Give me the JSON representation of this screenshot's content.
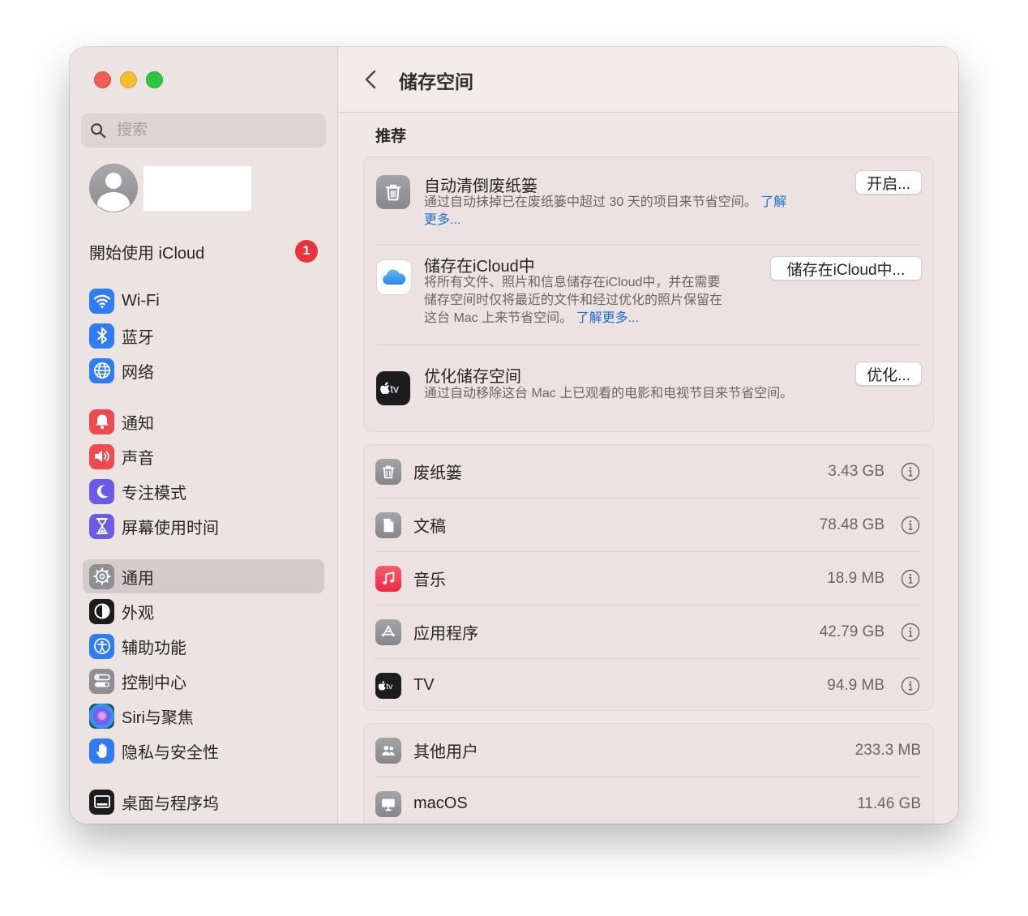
{
  "sidebar": {
    "search_placeholder": "搜索",
    "icloud_prompt": "開始使用 iCloud",
    "icloud_badge": "1",
    "items": [
      {
        "label": "Wi-Fi",
        "icon": "wifi-icon",
        "color": "#2f7cf6"
      },
      {
        "label": "蓝牙",
        "icon": "bluetooth-icon",
        "color": "#2f7cf6"
      },
      {
        "label": "网络",
        "icon": "globe-icon",
        "color": "#2f7cf6"
      },
      {
        "label": "通知",
        "icon": "bell-icon",
        "color": "#ee4a4f"
      },
      {
        "label": "声音",
        "icon": "speaker-icon",
        "color": "#ee4a4f"
      },
      {
        "label": "专注模式",
        "icon": "moon-icon",
        "color": "#6a5ce6"
      },
      {
        "label": "屏幕使用时间",
        "icon": "hourglass-icon",
        "color": "#6a5ce6"
      },
      {
        "label": "通用",
        "icon": "gear-icon",
        "color": "#8e8e93"
      },
      {
        "label": "外观",
        "icon": "appearance-icon",
        "color": "#1c1c1e"
      },
      {
        "label": "辅助功能",
        "icon": "accessibility-icon",
        "color": "#2f7cf6"
      },
      {
        "label": "控制中心",
        "icon": "control-center-icon",
        "color": "#8e8e93"
      },
      {
        "label": "Siri与聚焦",
        "icon": "siri-icon",
        "color": "#1c1c1e"
      },
      {
        "label": "隐私与安全性",
        "icon": "hand-icon",
        "color": "#2f7cf6"
      },
      {
        "label": "桌面与程序坞",
        "icon": "dock-icon",
        "color": "#1c1c1e"
      }
    ],
    "selected": "通用"
  },
  "header": {
    "title": "储存空间"
  },
  "recommendations": {
    "section_title": "推荐",
    "items": [
      {
        "title": "自动清倒废纸篓",
        "desc_line1": "通过自动抹掉已在废纸篓中超过 30 天的项目来节省空间。",
        "link_part1": "了解",
        "link_part2": "更多...",
        "button": "开启..."
      },
      {
        "title": "储存在iCloud中",
        "desc_line1": "将所有文件、照片和信息储存在iCloud中，并在需要",
        "desc_line2": "储存空间时仅将最近的文件和经过优化的照片保留在",
        "desc_line3": "这台 Mac 上来节省空间。",
        "link": "了解更多...",
        "button": "储存在iCloud中..."
      },
      {
        "title": "优化储存空间",
        "desc_line1": "通过自动移除这台 Mac 上已观看的电影和电视节目来节省空间。",
        "button": "优化..."
      }
    ]
  },
  "storage": [
    {
      "label": "废纸篓",
      "size": "3.43 GB",
      "icon": "trash-icon"
    },
    {
      "label": "文稿",
      "size": "78.48 GB",
      "icon": "document-icon"
    },
    {
      "label": "音乐",
      "size": "18.9 MB",
      "icon": "music-icon"
    },
    {
      "label": "应用程序",
      "size": "42.79 GB",
      "icon": "app-store-icon"
    },
    {
      "label": "TV",
      "size": "94.9 MB",
      "icon": "apple-tv-icon"
    }
  ],
  "storage_other": [
    {
      "label": "其他用户",
      "size": "233.3 MB",
      "icon": "users-icon"
    },
    {
      "label": "macOS",
      "size": "11.46 GB",
      "icon": "display-icon"
    }
  ],
  "tv_icon_text": "tv"
}
